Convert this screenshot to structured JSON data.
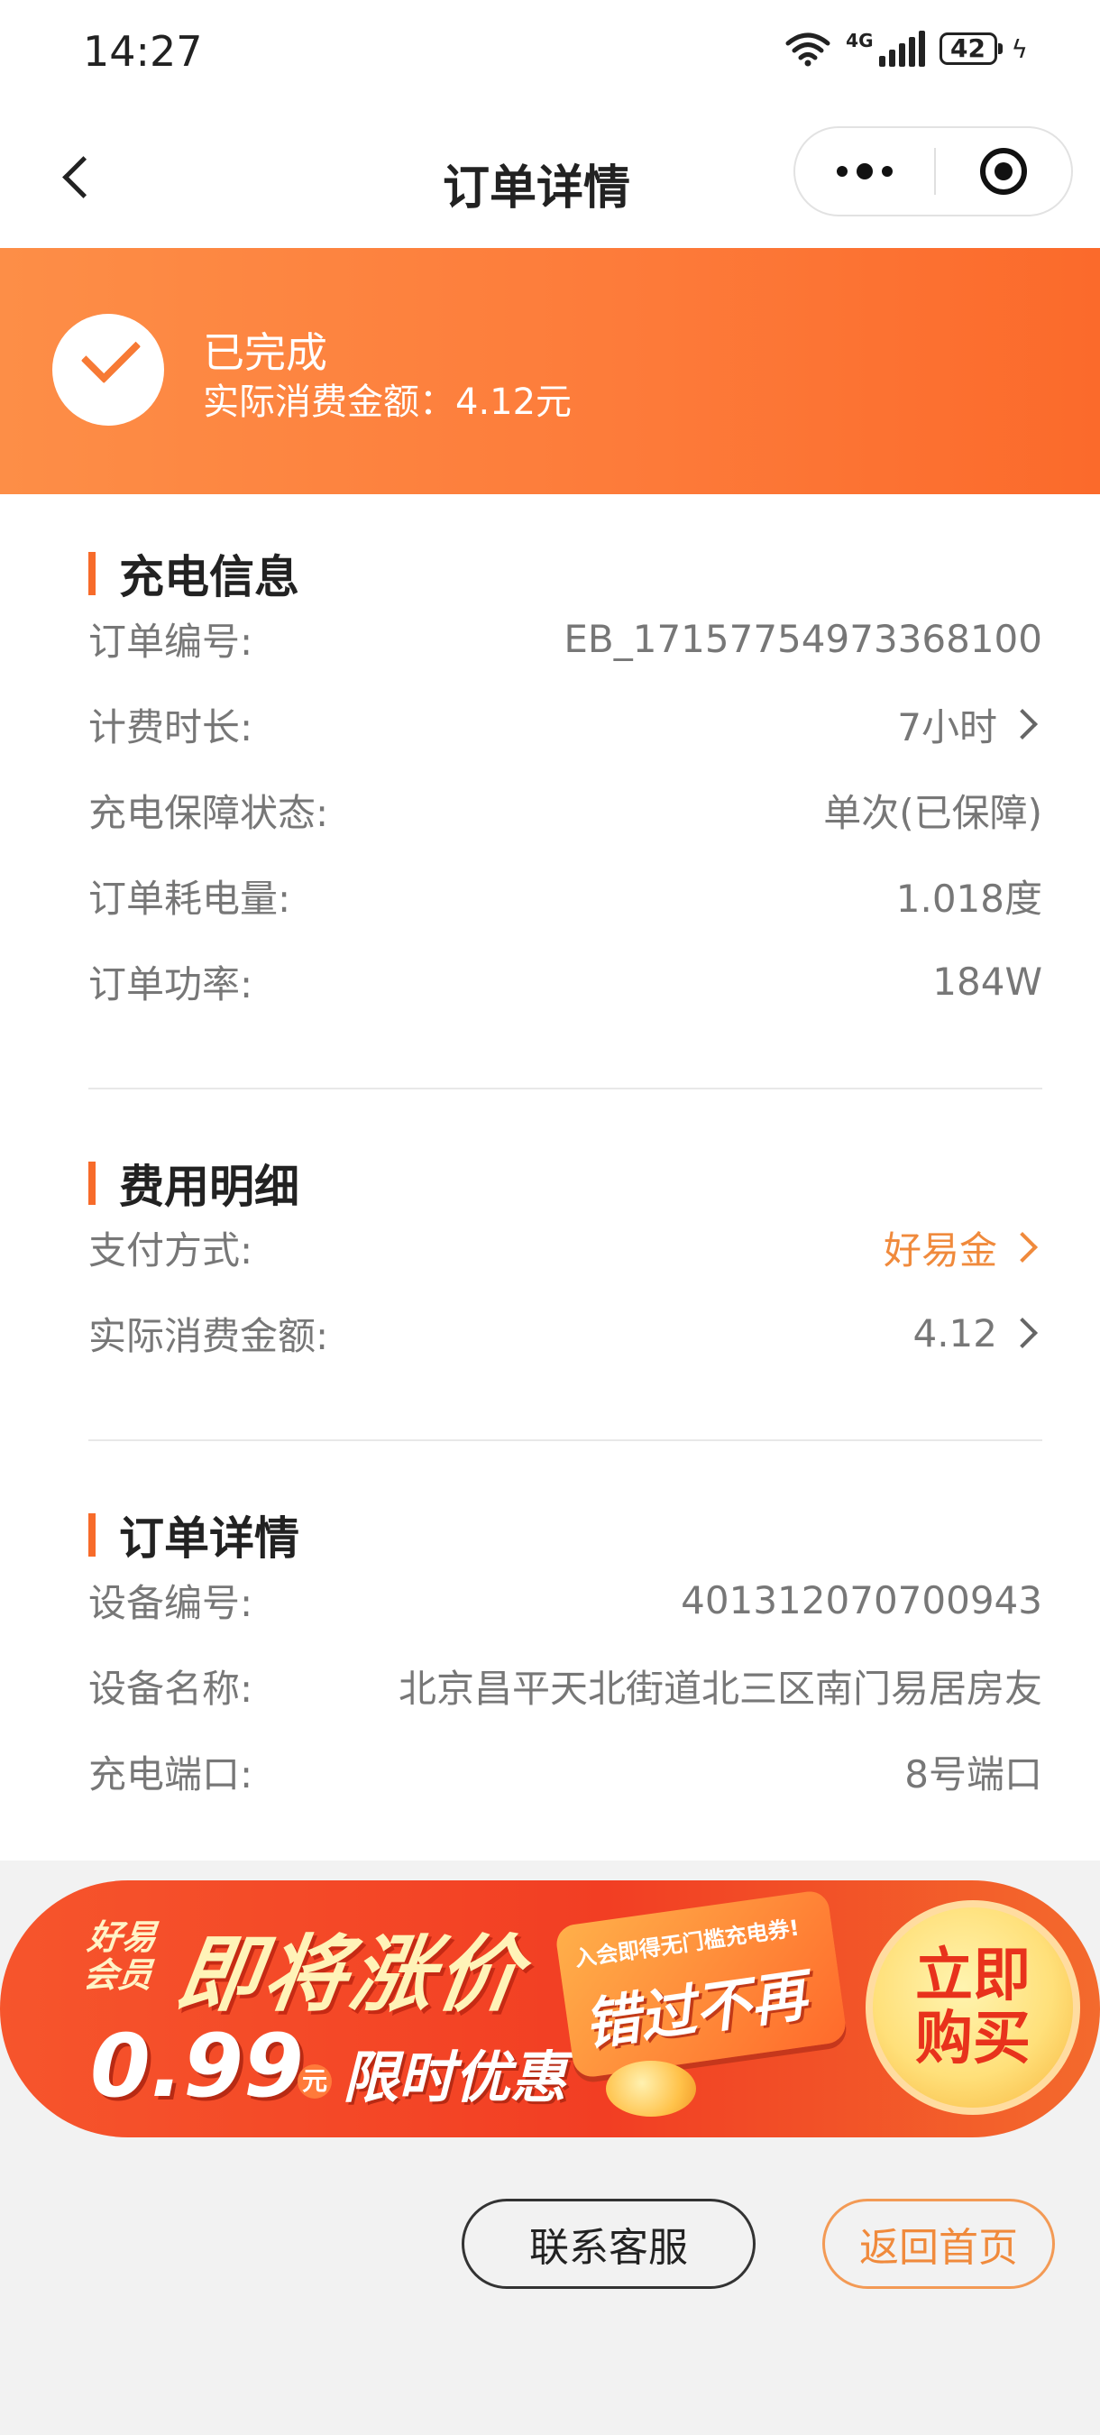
{
  "status_bar": {
    "time": "14:27",
    "network": "4G",
    "battery": "42"
  },
  "nav": {
    "title": "订单详情"
  },
  "banner": {
    "status": "已完成",
    "amount": "实际消费金额：4.12元"
  },
  "sections": {
    "charging": {
      "title": "充电信息",
      "rows": [
        {
          "label": "订单编号:",
          "value": "EB_17157754973368100"
        },
        {
          "label": "计费时长:",
          "value": "7小时"
        },
        {
          "label": "充电保障状态:",
          "value": "单次(已保障)"
        },
        {
          "label": "订单耗电量:",
          "value": "1.018度"
        },
        {
          "label": "订单功率:",
          "value": "184W"
        }
      ]
    },
    "fees": {
      "title": "费用明细",
      "rows": [
        {
          "label": "支付方式:",
          "value": "好易金"
        },
        {
          "label": "实际消费金额:",
          "value": "4.12"
        }
      ]
    },
    "order": {
      "title": "订单详情",
      "rows": [
        {
          "label": "设备编号:",
          "value": "401312070700943"
        },
        {
          "label": "设备名称:",
          "value": "北京昌平天北街道北三区南门易居房友"
        },
        {
          "label": "充电端口:",
          "value": "8号端口"
        }
      ]
    }
  },
  "promo": {
    "badge_line1": "好易",
    "badge_line2": "会员",
    "headline": "即将涨价",
    "price": "0.99",
    "unit": "元",
    "limited": "限时优惠",
    "tag_small": "入会即得无门槛充电券!",
    "tag_big": "错过不再",
    "buy": "立即购买"
  },
  "buttons": {
    "service": "联系客服",
    "home": "返回首页"
  },
  "colors": {
    "accent": "#f76b2a",
    "banner": "#fd7a39",
    "link": "#f08a3c"
  }
}
